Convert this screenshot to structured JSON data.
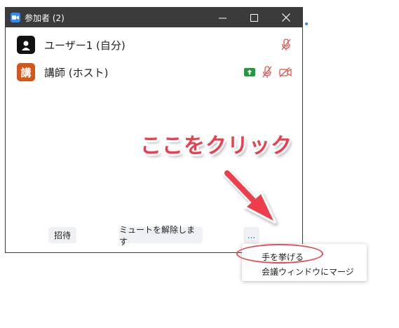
{
  "window": {
    "title": "参加者 (2)",
    "controls": [
      "minimize-icon",
      "maximize-icon",
      "close-icon"
    ]
  },
  "participants": [
    {
      "name": "ユーザー1 (自分)",
      "avatar_icon": "user-silhouette-icon",
      "status_icons": [
        "mic-muted-icon"
      ]
    },
    {
      "name": "講師 (ホスト)",
      "avatar_text": "講",
      "status_icons": [
        "screen-share-icon",
        "mic-muted-icon",
        "video-off-icon"
      ]
    }
  ],
  "footer": {
    "invite_label": "招待",
    "unmute_label": "ミュートを解除します",
    "more_label": "..."
  },
  "menu": {
    "items": [
      "手を挙げる",
      "会議ウィンドウにマージ"
    ]
  },
  "annotation": {
    "callout": "ここをクリック",
    "accent_color": "#ee3d4c"
  },
  "colors": {
    "titlebar": "#3b3b3b",
    "host_avatar": "#d4561b",
    "share_badge": "#1f9d3c",
    "muted_icon": "#e5504b"
  }
}
